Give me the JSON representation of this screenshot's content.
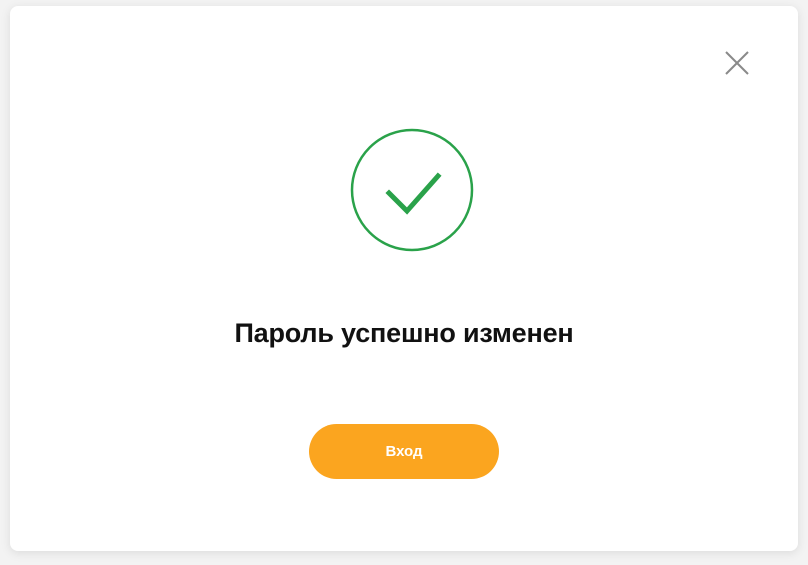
{
  "modal": {
    "title": "Пароль успешно изменен",
    "login_button_label": "Вход",
    "success_icon": "check-circle-icon",
    "close_icon": "close-icon"
  },
  "colors": {
    "success_green": "#2aa24a",
    "button_orange": "#fba51f",
    "close_gray": "#8a8a8a"
  }
}
